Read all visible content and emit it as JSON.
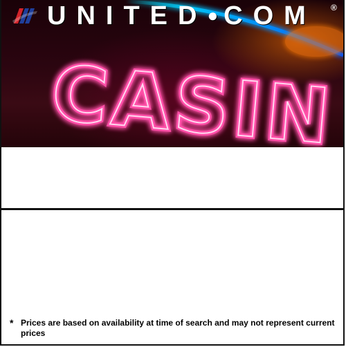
{
  "banner": {
    "brand": "UNITED",
    "brand_dot": "●",
    "brand_tld": "COM",
    "registered": "®",
    "neon_word": "CASIN"
  },
  "disclaimer": {
    "marker": "*",
    "text": "Prices are based on availability at time of search and may not represent current prices"
  },
  "colors": {
    "neon_pink": "#ff4fa8",
    "logo_red": "#d2232a",
    "logo_blue": "#1f3f9b",
    "banner_bg": "#2b0510",
    "border": "#111111"
  }
}
